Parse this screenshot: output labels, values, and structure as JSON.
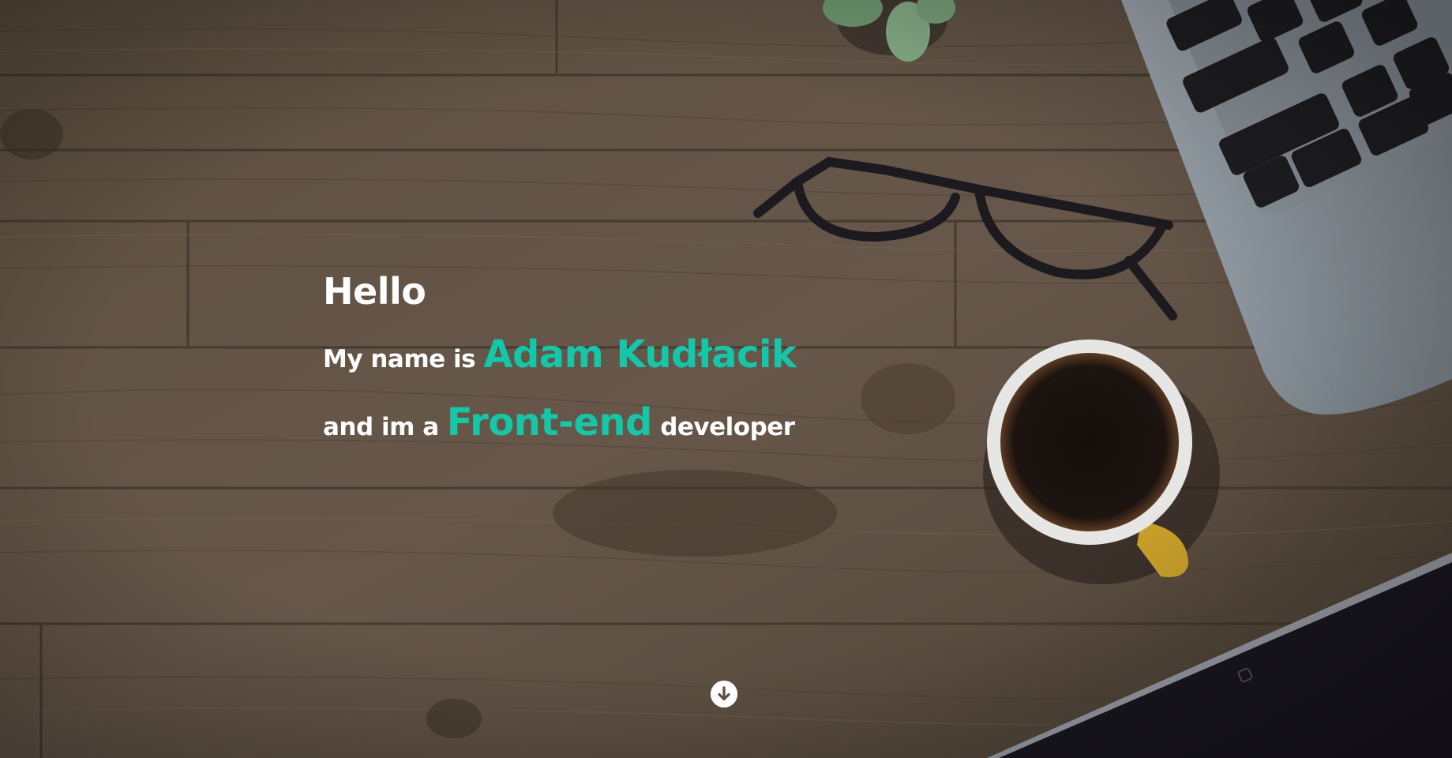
{
  "hero": {
    "greeting": "Hello",
    "name_prefix": "My name is",
    "name": "Adam Kudłacik",
    "role_prefix": "and im a",
    "role": "Front-end",
    "role_suffix": "developer",
    "scroll_icon": "arrow-down-circle-icon"
  },
  "colors": {
    "accent": "#14c7a8",
    "text": "#ffffff"
  }
}
